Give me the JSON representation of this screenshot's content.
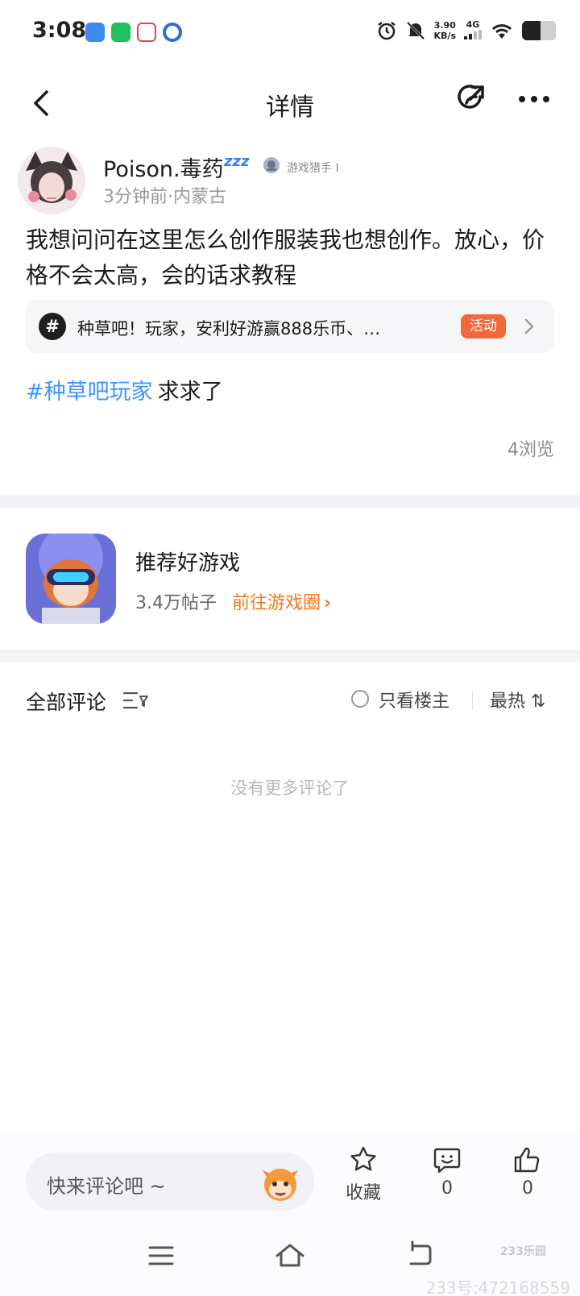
{
  "status_bar": {
    "time": "3:08",
    "net_speed_value": "3.90",
    "net_speed_unit": "KB/s",
    "network": "4G",
    "battery_level": 0.55,
    "app_icons": [
      "blue-app-icon",
      "wechat-icon",
      "calendar-app-icon",
      "blue-circle-app-icon"
    ]
  },
  "nav": {
    "back_icon": "chevron-left-icon",
    "title": "详情",
    "share_icon": "share-icon",
    "more_icon": "more-dots-icon"
  },
  "post": {
    "username": "Poison.毒药",
    "username_suffix": "zzz",
    "badge_text": "游戏猎手 I",
    "time_location": "3分钟前·内蒙古",
    "content": "我想问问在这里怎么创作服装我也想创作。放心，价格不会太高，会的话求教程",
    "topic": {
      "hash_symbol": "#",
      "text": "种草吧！玩家，安利好游赢888乐币、…",
      "tag": "活动"
    },
    "hashtag": "#种草吧玩家",
    "hashtag_rest": "求求了",
    "views": "4浏览"
  },
  "game_circle": {
    "name": "推荐好游戏",
    "posts": "3.4万帖子",
    "link": "前往游戏圈",
    "link_arrow": "›"
  },
  "comments": {
    "title": "全部评论",
    "only_op": "只看楼主",
    "sort": "最热 ⇅",
    "empty": "没有更多评论了"
  },
  "bottom_bar": {
    "placeholder": "快来评论吧 ~",
    "favorite_label": "收藏",
    "comment_count": "0",
    "like_count": "0"
  },
  "watermark": {
    "brand": "233乐园",
    "id": "233号:472168559"
  },
  "colors": {
    "accent_orange": "#f07a1c",
    "tag_orange": "#f2683a",
    "hashtag_blue": "#3e95ff"
  }
}
